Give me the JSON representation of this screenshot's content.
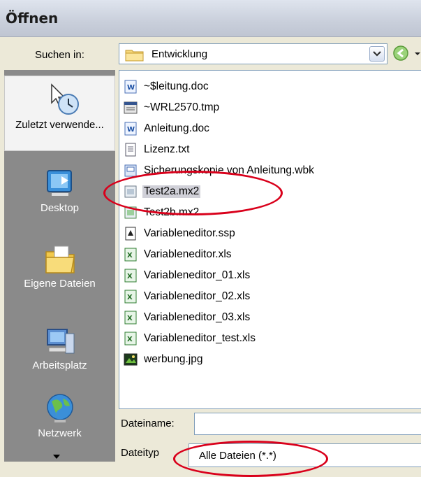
{
  "window": {
    "title": "Öffnen"
  },
  "lookin": {
    "label": "Suchen in:",
    "value": "Entwicklung"
  },
  "places": [
    {
      "label": "Zuletzt verwende...",
      "icon": "recent-icon"
    },
    {
      "label": "Desktop",
      "icon": "desktop-icon"
    },
    {
      "label": "Eigene Dateien",
      "icon": "my-documents-icon"
    },
    {
      "label": "Arbeitsplatz",
      "icon": "my-computer-icon"
    },
    {
      "label": "Netzwerk",
      "icon": "network-icon"
    }
  ],
  "files": [
    {
      "name": "~$leitung.doc",
      "icon": "word-doc-icon"
    },
    {
      "name": "~WRL2570.tmp",
      "icon": "tmp-file-icon"
    },
    {
      "name": "Anleitung.doc",
      "icon": "word-doc-icon"
    },
    {
      "name": "Lizenz.txt",
      "icon": "text-file-icon"
    },
    {
      "name": "Sicherungskopie von Anleitung.wbk",
      "icon": "backup-file-icon"
    },
    {
      "name": "Test2a.mx2",
      "icon": "mx2-file-icon",
      "selected": true
    },
    {
      "name": "Test2b.mx2",
      "icon": "mx2-file-icon"
    },
    {
      "name": "Variableneditor.ssp",
      "icon": "ssp-file-icon"
    },
    {
      "name": "Variableneditor.xls",
      "icon": "excel-file-icon"
    },
    {
      "name": "Variableneditor_01.xls",
      "icon": "excel-file-icon"
    },
    {
      "name": "Variableneditor_02.xls",
      "icon": "excel-file-icon"
    },
    {
      "name": "Variableneditor_03.xls",
      "icon": "excel-file-icon"
    },
    {
      "name": "Variableneditor_test.xls",
      "icon": "excel-file-icon"
    },
    {
      "name": "werbung.jpg",
      "icon": "image-file-icon"
    }
  ],
  "filename": {
    "label": "Dateiname:",
    "value": ""
  },
  "filetype": {
    "label": "Dateityp",
    "value": "Alle Dateien (*.*)"
  },
  "colors": {
    "highlight_ellipse": "#d9001b",
    "places_bar": "#8a8a8a"
  }
}
